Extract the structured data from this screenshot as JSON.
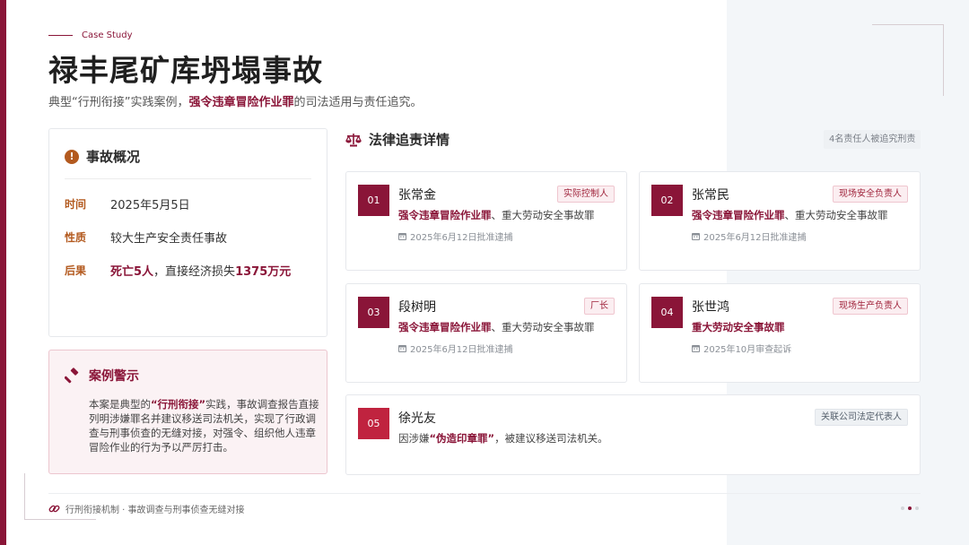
{
  "header": {
    "eyebrow": "Case Study",
    "title": "禄丰尾矿库坍塌事故",
    "subtitle_pre": "典型“行刑衔接”实践案例，",
    "subtitle_em": "强令违章冒险作业罪",
    "subtitle_post": "的司法适用与责任追究。"
  },
  "overview": {
    "title": "事故概况",
    "rows": [
      {
        "label": "时间",
        "value": "2025年5月5日"
      },
      {
        "label": "性质",
        "value": "较大生产安全责任事故"
      },
      {
        "label": "后果",
        "value_em1": "死亡5人",
        "value_mid": "，直接经济损失",
        "value_em2": "1375万元"
      }
    ]
  },
  "warning": {
    "title": "案例警示",
    "text_pre": "本案是典型的",
    "text_em": "“行刑衔接”",
    "text_post": "实践，事故调查报告直接列明涉嫌罪名并建议移送司法机关，实现了行政调查与刑事侦查的无缝对接，对强令、组织他人违章冒险作业的行为予以严厉打击。"
  },
  "legal": {
    "title": "法律追责详情",
    "count": "4名责任人被追究刑责",
    "people": [
      {
        "num": "01",
        "name": "张常金",
        "role": "实际控制人",
        "charge_em": "强令违章冒险作业罪",
        "charge_rest": "、重大劳动安全事故罪",
        "date": "2025年6月12日批准逮捕"
      },
      {
        "num": "02",
        "name": "张常民",
        "role": "现场安全负责人",
        "charge_em": "强令违章冒险作业罪",
        "charge_rest": "、重大劳动安全事故罪",
        "date": "2025年6月12日批准逮捕"
      },
      {
        "num": "03",
        "name": "段树明",
        "role": "厂长",
        "charge_em": "强令违章冒险作业罪",
        "charge_rest": "、重大劳动安全事故罪",
        "date": "2025年6月12日批准逮捕"
      },
      {
        "num": "04",
        "name": "张世鸿",
        "role": "现场生产负责人",
        "charge_em": "重大劳动安全事故罪",
        "charge_rest": "",
        "date": "2025年10月审查起诉"
      },
      {
        "num": "05",
        "name": "徐光友",
        "role": "关联公司法定代表人",
        "charge_pre": "因涉嫌",
        "charge_em": "“伪造印章罪”",
        "charge_rest": "，被建议移送司法机关。"
      }
    ]
  },
  "footer": {
    "text": "行刑衔接机制 · 事故调查与刑事侦查无缝对接",
    "page_dots": 3,
    "active_dot": 2
  },
  "colors": {
    "accent": "#8a1538",
    "orange": "#b35a1f"
  }
}
